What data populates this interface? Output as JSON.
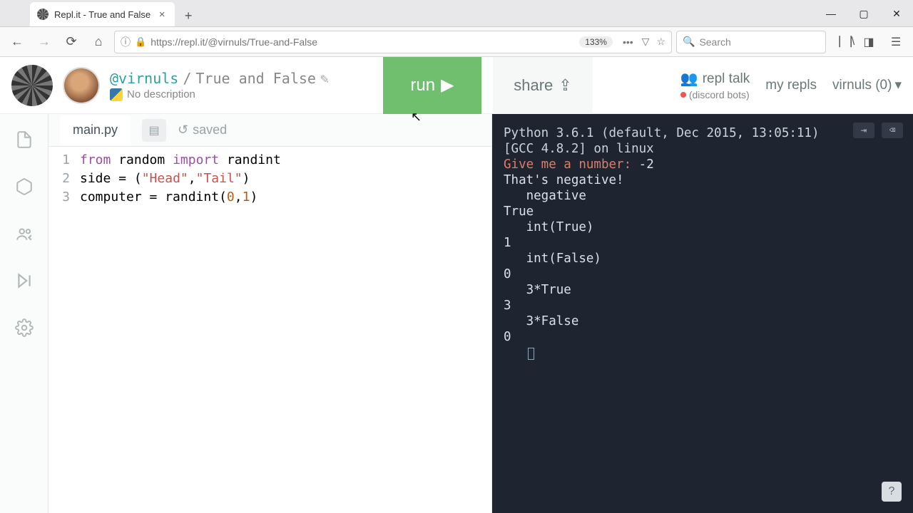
{
  "browser": {
    "tab_title": "Repl.it - True and False",
    "url": "https://repl.it/@virnuls/True-and-False",
    "zoom": "133%",
    "search_placeholder": "Search"
  },
  "window": {
    "min": "—",
    "max": "▢",
    "close": "✕"
  },
  "repl": {
    "user": "@virnuls",
    "sep": "/",
    "name": "True and False",
    "desc": "No description",
    "run": "run",
    "share": "share",
    "talk": "repl talk",
    "myrepls": "my repls",
    "username": "virnuls (0)",
    "discord": "(discord bots)"
  },
  "editor": {
    "filename": "main.py",
    "saved": "saved",
    "lines": {
      "1": {
        "kw1": "from",
        "mod": "random",
        "kw2": "import",
        "name": "randint"
      },
      "2": {
        "lhs": "side",
        "eq": " = (",
        "s1": "\"Head\"",
        "comma": ",",
        "s2": "\"Tail\"",
        "end": ")"
      },
      "3": {
        "lhs": "computer",
        "eq": " = randint(",
        "n1": "0",
        "comma": ",",
        "n2": "1",
        "end": ")"
      }
    },
    "nums": {
      "1": "1",
      "2": "2",
      "3": "3"
    }
  },
  "terminal": {
    "ver1": "Python 3.6.1 (default,  Dec 2015, 13:05:11)",
    "ver2": "[GCC 4.8.2] on linux",
    "prompt": "Give me a number: ",
    "inp": "-2",
    "out1": "That's negative!",
    "rows": [
      {
        "in": "negative",
        "out": "True"
      },
      {
        "in": "int(True)",
        "out": "1"
      },
      {
        "in": "int(False)",
        "out": "0"
      },
      {
        "in": "3*True",
        "out": "3"
      },
      {
        "in": "3*False",
        "out": "0"
      }
    ]
  }
}
